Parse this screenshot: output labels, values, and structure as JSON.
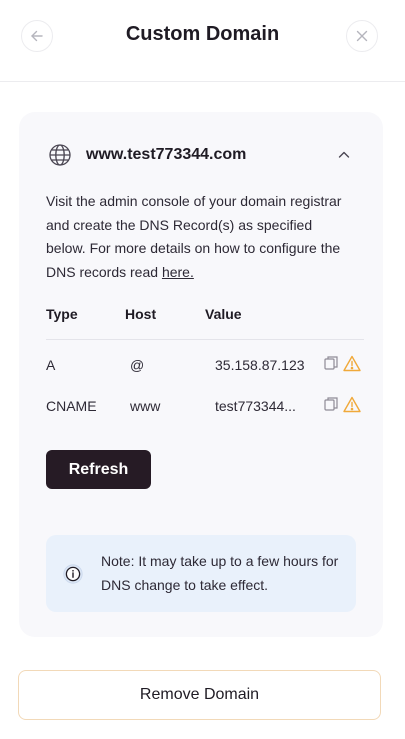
{
  "header": {
    "title": "Custom Domain",
    "back_icon": "arrow-left-icon",
    "close_icon": "close-icon"
  },
  "domain": {
    "name": "www.test773344.com",
    "globe_icon": "globe-icon",
    "collapse_icon": "chevron-up-icon",
    "description": "Visit the admin console of your domain registrar and create the DNS Record(s) as specified below. For more details on how to configure the DNS records read ",
    "link_text": "here."
  },
  "table": {
    "headers": {
      "type": "Type",
      "host": "Host",
      "value": "Value"
    },
    "rows": [
      {
        "type": "A",
        "host": "@",
        "value": "35.158.87.123"
      },
      {
        "type": "CNAME",
        "host": "www",
        "value": "test773344..."
      }
    ],
    "copy_icon": "copy-icon",
    "warning_icon": "warning-icon"
  },
  "refresh_label": "Refresh",
  "note": {
    "icon": "info-icon",
    "text": "Note: It may take up to a few hours for DNS change to take effect."
  },
  "remove_label": "Remove Domain",
  "colors": {
    "primary_dark": "#261b25",
    "card_bg": "#f8f8fb",
    "note_bg": "#e9f1fb",
    "warning": "#f0a93a",
    "remove_border": "#f2d9b8"
  }
}
